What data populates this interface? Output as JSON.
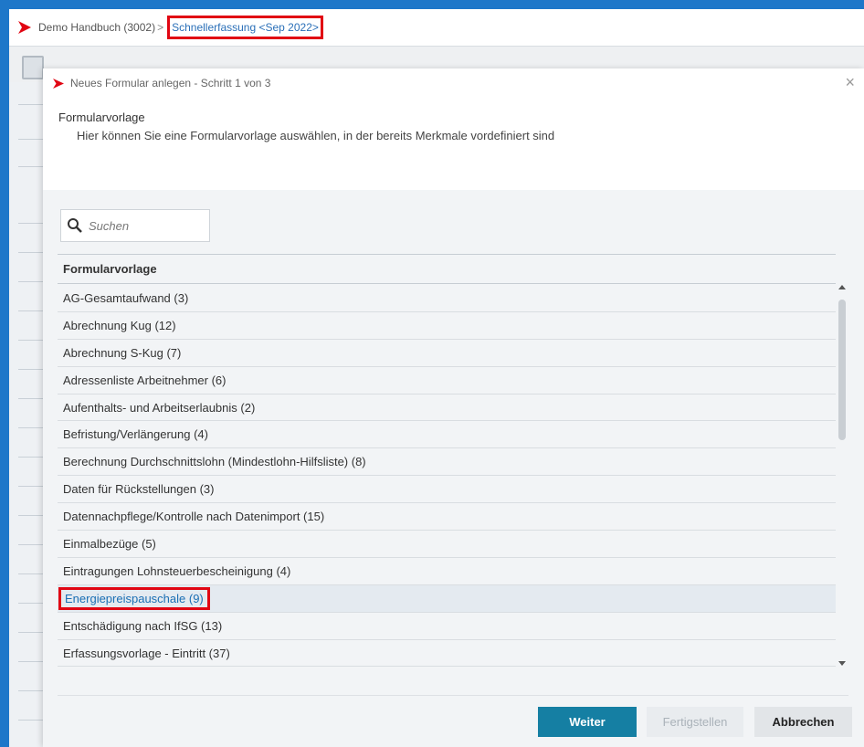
{
  "app": {
    "breadcrumb_root": "Demo Handbuch (3002)",
    "breadcrumb_separator": ">",
    "breadcrumb_active": "Schnellerfassung <Sep 2022>"
  },
  "dialog": {
    "title": "Neues Formular anlegen - Schritt 1 von 3",
    "close_symbol": "×",
    "step_title": "Formularvorlage",
    "step_description": "Hier können Sie eine Formularvorlage auswählen, in der bereits Merkmale vordefiniert sind",
    "search_placeholder": "Suchen",
    "list_header": "Formularvorlage",
    "items": [
      "AG-Gesamtaufwand (3)",
      "Abrechnung Kug (12)",
      "Abrechnung S-Kug (7)",
      "Adressenliste Arbeitnehmer (6)",
      "Aufenthalts- und Arbeitserlaubnis (2)",
      "Befristung/Verlängerung (4)",
      "Berechnung Durchschnittslohn (Mindestlohn-Hilfsliste) (8)",
      "Daten für Rückstellungen (3)",
      "Datennachpflege/Kontrolle nach Datenimport (15)",
      "Einmalbezüge (5)",
      "Eintragungen Lohnsteuerbescheinigung (4)",
      "Energiepreispauschale (9)",
      "Entschädigung nach IfSG (13)",
      "Erfassungsvorlage - Eintritt (37)"
    ],
    "selected_index": 11,
    "buttons": {
      "next": "Weiter",
      "finish": "Fertigstellen",
      "cancel": "Abbrechen"
    }
  },
  "colors": {
    "brand_red": "#e10613",
    "frame_blue": "#1e77c9",
    "primary_button": "#157fa3",
    "selected_row": "#e4eaf0"
  }
}
